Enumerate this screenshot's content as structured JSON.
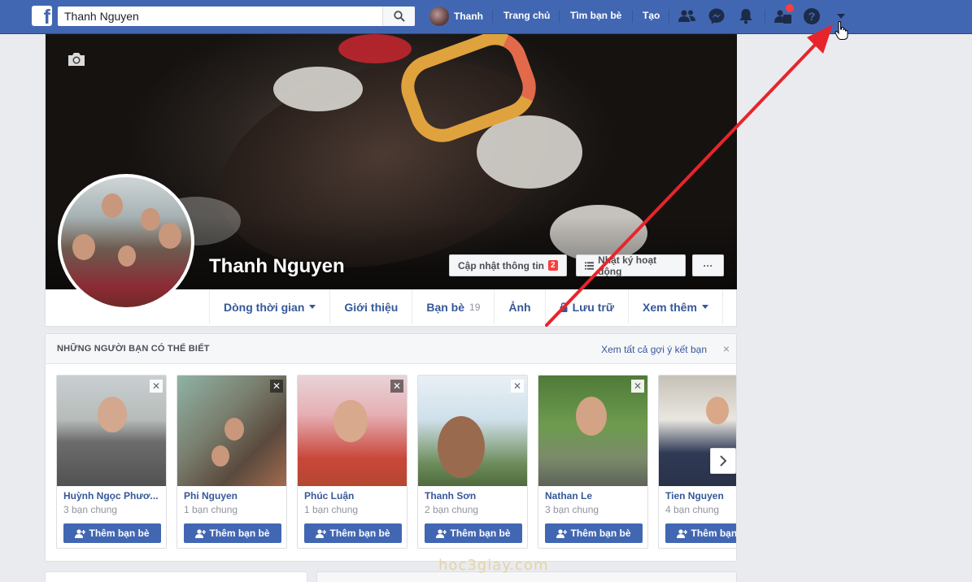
{
  "topbar": {
    "search_value": "Thanh Nguyen",
    "user_name": "Thanh",
    "links": {
      "home": "Trang chủ",
      "find_friends": "Tìm bạn bè",
      "create": "Tạo"
    }
  },
  "profile": {
    "name": "Thanh Nguyen",
    "update_info_label": "Cập nhật thông tin",
    "update_info_badge": "2",
    "activity_log_label": "Nhật ký hoạt động",
    "more_label": "···"
  },
  "tabs": [
    {
      "label": "Dòng thời gian"
    },
    {
      "label": "Giới thiệu"
    },
    {
      "label": "Bạn bè",
      "count": "19"
    },
    {
      "label": "Ảnh"
    },
    {
      "label": "Lưu trữ"
    },
    {
      "label": "Xem thêm"
    }
  ],
  "pymk": {
    "title": "NHỮNG NGƯỜI BẠN CÓ THỂ BIẾT",
    "see_all": "Xem tất cả gợi ý kết bạn",
    "close": "×",
    "add_label": "Thêm bạn bè",
    "people": [
      {
        "name": "Huỳnh Ngọc Phươ...",
        "mutual": "3 bạn chung"
      },
      {
        "name": "Phi Nguyen",
        "mutual": "1 bạn chung"
      },
      {
        "name": "Phúc Luận",
        "mutual": "1 bạn chung"
      },
      {
        "name": "Thanh Sơn",
        "mutual": "2 bạn chung"
      },
      {
        "name": "Nathan Le",
        "mutual": "3 bạn chung"
      },
      {
        "name": "Tien Nguyen",
        "mutual": "4 bạn chung"
      }
    ]
  },
  "watermark": "hoc3giay.com",
  "colors": {
    "brand": "#4267b2",
    "link": "#365899",
    "annotation_arrow": "#e8242b"
  }
}
